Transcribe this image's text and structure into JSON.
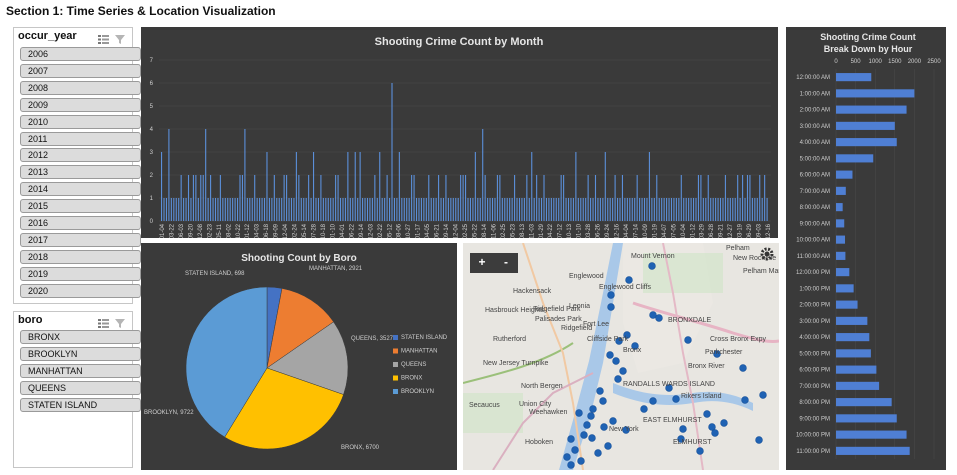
{
  "page": {
    "section_title": "Section 1: Time Series & Location Visualization"
  },
  "slicers": {
    "year": {
      "title": "occur_year",
      "items": [
        "2006",
        "2007",
        "2008",
        "2009",
        "2010",
        "2011",
        "2012",
        "2013",
        "2014",
        "2015",
        "2016",
        "2017",
        "2018",
        "2019",
        "2020"
      ]
    },
    "boro": {
      "title": "boro",
      "items": [
        "BRONX",
        "BROOKLYN",
        "MANHATTAN",
        "QUEENS",
        "STATEN ISLAND"
      ]
    }
  },
  "map": {
    "zoom_in": "+",
    "zoom_out": "-",
    "labels": [
      "Mount Vernon",
      "Pelham",
      "New Rochelle",
      "Pelham Manor",
      "Englewood",
      "Englewood Cliffs",
      "Leonia",
      "Hackensack",
      "Hasbrouck Heights",
      "Ridgefield Park",
      "Palisades Park",
      "Rutherford",
      "Fort Lee",
      "Cliffside Park",
      "Ridgefield",
      "Bronx",
      "BRONXDALE",
      "Parkchester",
      "Bronx River",
      "North Bergen",
      "Union City",
      "Weehawken",
      "RANDALLS WARDS ISLAND",
      "Rikers Island",
      "Secaucus",
      "New York",
      "Hoboken",
      "EAST ELMHURST",
      "ELMHURST",
      "New Jersey Turnpike",
      "Cross Bronx Expy"
    ]
  },
  "chart_data": [
    {
      "type": "bar",
      "title": "Shooting Crime Count by Month",
      "xlabel": "",
      "ylabel": "",
      "ylim": [
        0,
        7
      ],
      "yticks": [
        0,
        1,
        2,
        3,
        4,
        5,
        6,
        7
      ],
      "categories": [
        "2006-01-04",
        "2006-03-22",
        "2006-06-03",
        "2006-09-20",
        "2006-12-08",
        "2007-02-23",
        "2007-05-11",
        "2007-08-02",
        "2007-10-22",
        "2008-01-12",
        "2008-04-03",
        "2008-06-18",
        "2008-09-09",
        "2008-12-04",
        "2009-02-24",
        "2009-05-14",
        "2009-07-28",
        "2009-10-18",
        "2010-01-10",
        "2010-04-01",
        "2010-06-22",
        "2010-09-14",
        "2010-12-03",
        "2011-02-22",
        "2011-05-12",
        "2011-08-06",
        "2011-10-27",
        "2012-01-17",
        "2012-04-05",
        "2012-06-21",
        "2012-09-14",
        "2012-12-04",
        "2013-02-25",
        "2013-05-22",
        "2013-08-14",
        "2013-11-06",
        "2014-02-25",
        "2014-05-23",
        "2014-08-13",
        "2014-11-03",
        "2015-01-29",
        "2015-04-22",
        "2015-07-12",
        "2015-10-13",
        "2016-01-10",
        "2016-03-28",
        "2016-06-26",
        "2016-09-24",
        "2016-12-16",
        "2017-04-04",
        "2017-07-14",
        "2017-10-09",
        "2018-01-19",
        "2018-04-07",
        "2018-07-05",
        "2018-10-04",
        "2019-01-12",
        "2019-03-29",
        "2019-06-28",
        "2019-09-21",
        "2019-12-27",
        "2020-03-19",
        "2020-06-29",
        "2020-09-03",
        "2020-12-16"
      ],
      "values": [
        3,
        1,
        1,
        4,
        1,
        1,
        1,
        1,
        2,
        1,
        1,
        2,
        1,
        2,
        2,
        1,
        2,
        2,
        4,
        1,
        2,
        1,
        1,
        1,
        2,
        1,
        1,
        1,
        1,
        1,
        1,
        1,
        2,
        2,
        4,
        1,
        1,
        1,
        2,
        1,
        1,
        1,
        1,
        3,
        1,
        1,
        2,
        1,
        1,
        1,
        2,
        2,
        1,
        1,
        1,
        3,
        2,
        1,
        1,
        1,
        2,
        1,
        3,
        1,
        1,
        2,
        1,
        1,
        1,
        1,
        1,
        2,
        2,
        1,
        1,
        1,
        3,
        1,
        1,
        3,
        1,
        3,
        1,
        1,
        1,
        1,
        1,
        2,
        1,
        3,
        1,
        1,
        2,
        1,
        6,
        1,
        1,
        3,
        1,
        1,
        1,
        1,
        2,
        2,
        1,
        1,
        1,
        1,
        1,
        2,
        1,
        1,
        1,
        2,
        1,
        1,
        2,
        1,
        1,
        1,
        1,
        1,
        2,
        2,
        2,
        1,
        1,
        1,
        3,
        1,
        1,
        4,
        2,
        1,
        1,
        1,
        1,
        2,
        2,
        1,
        1,
        1,
        1,
        1,
        2,
        1,
        1,
        1,
        1,
        2,
        1,
        3,
        1,
        2,
        1,
        1,
        2,
        1,
        1,
        1,
        1,
        1,
        1,
        2,
        2,
        1,
        1,
        1,
        1,
        3,
        1,
        1,
        1,
        1,
        2,
        1,
        1,
        2,
        1,
        1,
        1,
        3,
        1,
        1,
        1,
        2,
        1,
        1,
        2,
        1,
        1,
        1,
        1,
        1,
        2,
        1,
        1,
        1,
        1,
        3,
        1,
        1,
        2,
        1,
        1,
        1,
        1,
        1,
        1,
        1,
        1,
        1,
        2,
        1,
        1,
        1,
        1,
        1,
        1,
        2,
        2,
        1,
        1,
        2,
        1,
        1,
        1,
        1,
        1,
        1,
        2,
        1,
        1,
        1,
        1,
        2,
        1,
        2,
        1,
        2,
        2,
        1,
        1,
        1,
        2,
        1,
        2,
        1
      ]
    },
    {
      "type": "pie",
      "title": "Shooting Count by Boro",
      "labels": [
        "STATEN ISLAND",
        "MANHATTAN",
        "QUEENS",
        "BRONX",
        "BROOKLYN"
      ],
      "values": [
        698,
        2921,
        3527,
        6700,
        9722
      ],
      "data_labels": [
        "STATEN ISLAND, 698",
        "MANHATTAN, 2921",
        "QUEENS, 3527",
        "BRONX, 6700",
        "BROOKLYN, 9722"
      ],
      "colors": [
        "#4472c4",
        "#ed7d31",
        "#a5a5a5",
        "#ffc000",
        "#5b9bd5"
      ],
      "legend": "right"
    },
    {
      "type": "bar",
      "orientation": "horizontal",
      "title": "Shooting Crime Count Break Down by Hour",
      "title_lines": [
        "Shooting Crime Count",
        "Break Down by Hour"
      ],
      "xlim": [
        0,
        2500
      ],
      "xticks": [
        "0",
        "500",
        "1000",
        "1500",
        "2000",
        "2500"
      ],
      "categories": [
        "12:00:00 AM",
        "1:00:00 AM",
        "2:00:00 AM",
        "3:00:00 AM",
        "4:00:00 AM",
        "5:00:00 AM",
        "6:00:00 AM",
        "7:00:00 AM",
        "8:00:00 AM",
        "9:00:00 AM",
        "10:00:00 AM",
        "11:00:00 AM",
        "12:00:00 PM",
        "1:00:00 PM",
        "2:00:00 PM",
        "3:00:00 PM",
        "4:00:00 PM",
        "5:00:00 PM",
        "6:00:00 PM",
        "7:00:00 PM",
        "8:00:00 PM",
        "9:00:00 PM",
        "10:00:00 PM",
        "11:00:00 PM"
      ],
      "values": [
        900,
        2000,
        1800,
        1500,
        1550,
        950,
        420,
        250,
        170,
        210,
        230,
        240,
        340,
        450,
        550,
        800,
        850,
        890,
        1030,
        1100,
        1420,
        1550,
        1800,
        1880
      ]
    }
  ]
}
